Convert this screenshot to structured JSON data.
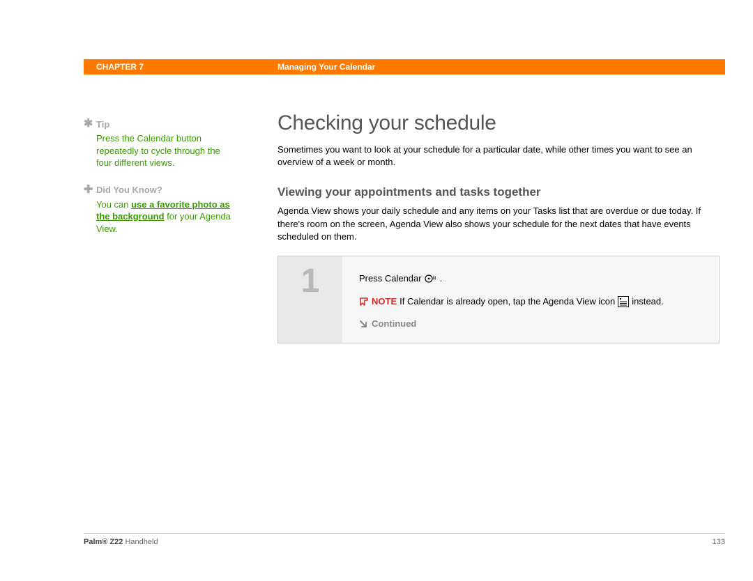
{
  "header": {
    "chapter": "CHAPTER 7",
    "title": "Managing Your Calendar"
  },
  "sidebar": {
    "tip": {
      "icon": "✱",
      "label": "Tip",
      "body": "Press the Calendar button repeatedly to cycle through the four different views."
    },
    "dyk": {
      "icon": "✚",
      "label": "Did You Know?",
      "prefix": "You can ",
      "link": "use a favorite photo as the background",
      "suffix": " for your Agenda View."
    }
  },
  "main": {
    "h1": "Checking your schedule",
    "intro": "Sometimes you want to look at your schedule for a particular date, while other times you want to see an overview of a week or month.",
    "h2": "Viewing your appointments and tasks together",
    "para": "Agenda View shows your daily schedule and any items on your Tasks list that are overdue or due today. If there's room on the screen, Agenda View also shows your schedule for the next dates that have events scheduled on them.",
    "step": {
      "num": "1",
      "press_text": "Press Calendar ",
      "press_suffix": ".",
      "note_label": "NOTE",
      "note_prefix": "If Calendar is already open, tap the Agenda View icon ",
      "note_suffix": " instead.",
      "continued": "Continued"
    }
  },
  "footer": {
    "product_bold": "Palm® Z22",
    "product_rest": " Handheld",
    "page": "133"
  }
}
